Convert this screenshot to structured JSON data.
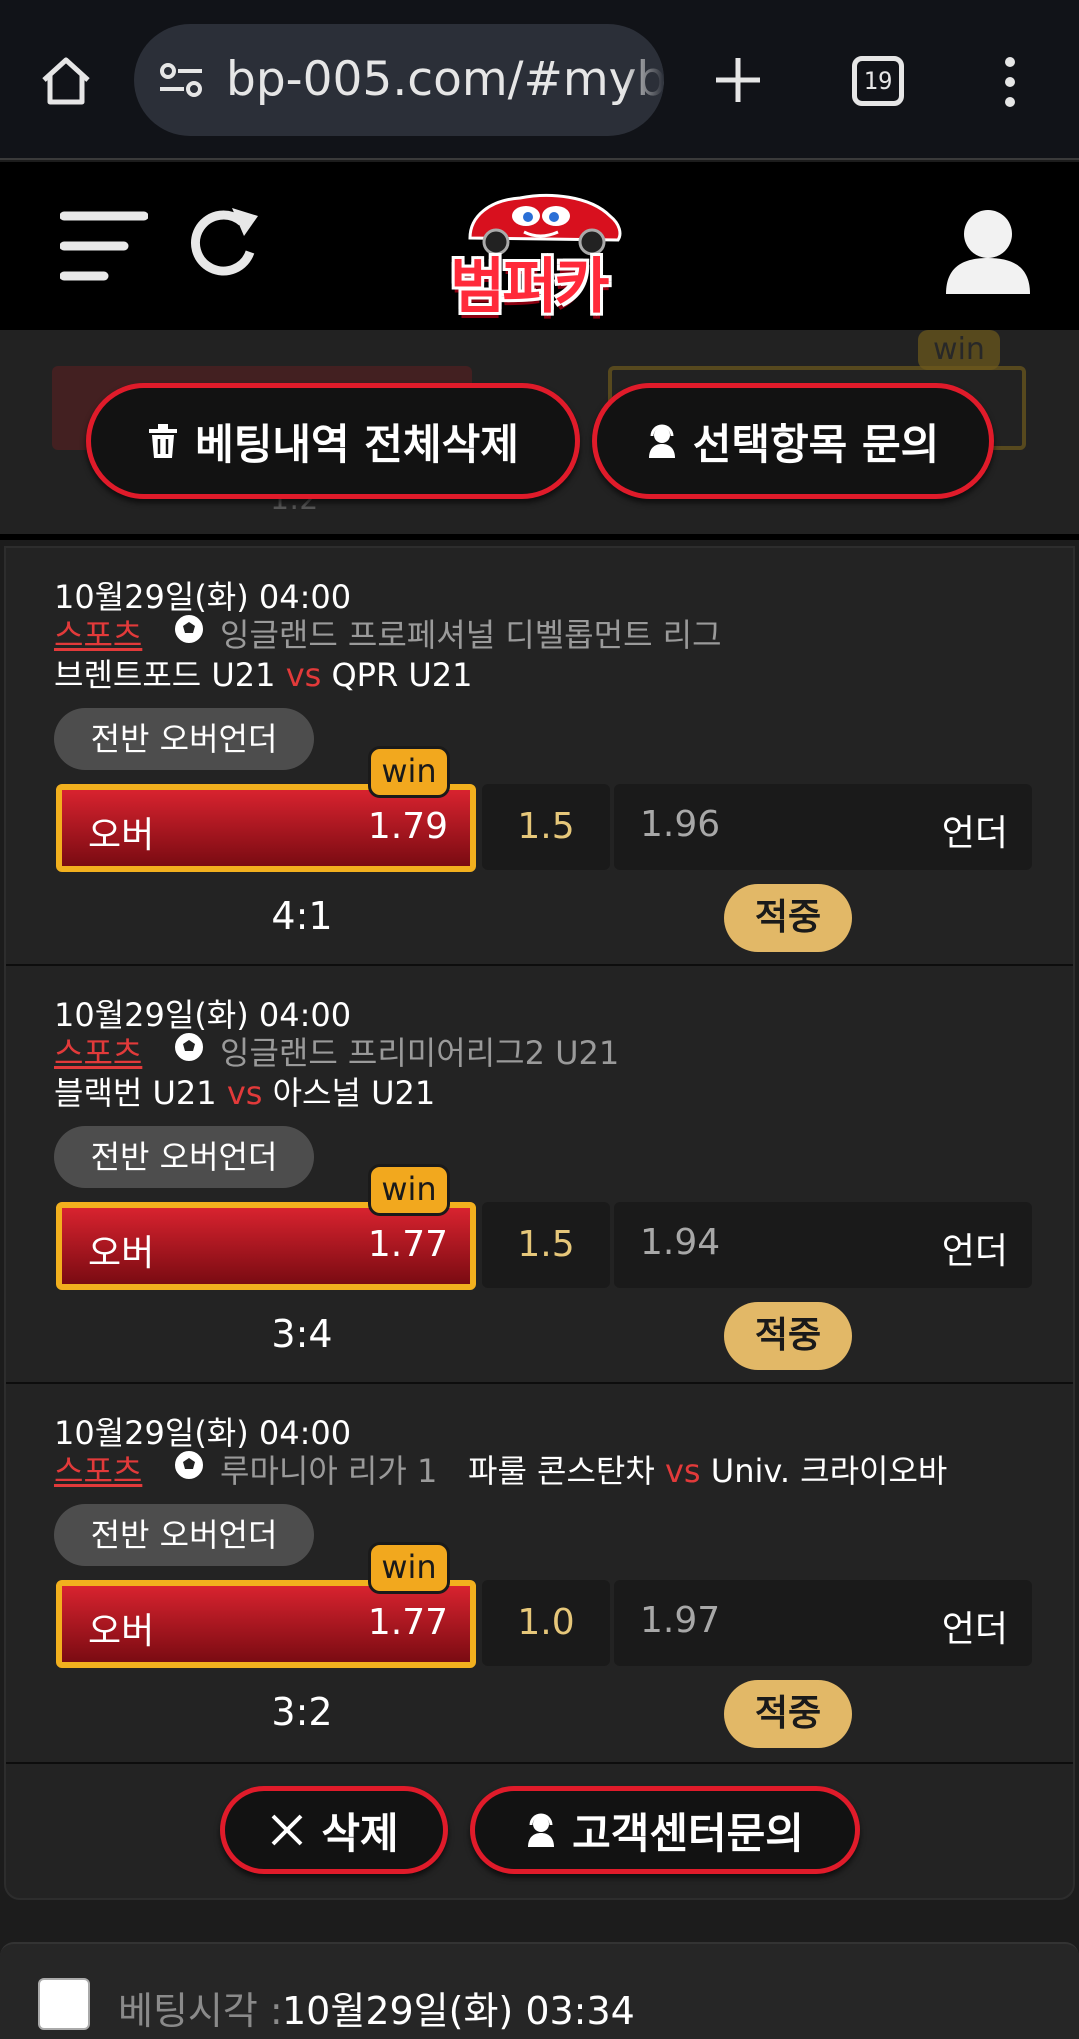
{
  "browser": {
    "url": "bp-005.com/#myb",
    "tab_count": "19"
  },
  "header": {
    "logo_text": "범퍼카"
  },
  "ghost": {
    "win": "win",
    "score": "1:2"
  },
  "actions": {
    "delete_all": "베팅내역 전체삭제",
    "inquiry_selected": "선택항목 문의",
    "delete": "삭제",
    "customer_center": "고객센터문의"
  },
  "matches": [
    {
      "datetime": "10월29일(화) 04:00",
      "category": "스포츠",
      "league": "잉글랜드 프로페셔널 디벨롭먼트 리그",
      "home": "브렌트포드 U21",
      "vs": "vs",
      "away": "QPR U21",
      "bet_type": "전반 오버언더",
      "over_label": "오버",
      "over_odds": "1.79",
      "win_tag": "win",
      "line": "1.5",
      "under_odds": "1.96",
      "under_label": "언더",
      "score": "4:1",
      "result": "적중"
    },
    {
      "datetime": "10월29일(화) 04:00",
      "category": "스포츠",
      "league": "잉글랜드 프리미어리그2 U21",
      "home": "블랙번 U21",
      "vs": "vs",
      "away": "아스널 U21",
      "bet_type": "전반 오버언더",
      "over_label": "오버",
      "over_odds": "1.77",
      "win_tag": "win",
      "line": "1.5",
      "under_odds": "1.94",
      "under_label": "언더",
      "score": "3:4",
      "result": "적중"
    },
    {
      "datetime": "10월29일(화) 04:00",
      "category": "스포츠",
      "league": "루마니아 리가 1",
      "home": "파룰 콘스탄차",
      "vs": "vs",
      "away": "Univ. 크라이오바",
      "bet_type": "전반 오버언더",
      "over_label": "오버",
      "over_odds": "1.77",
      "win_tag": "win",
      "line": "1.0",
      "under_odds": "1.97",
      "under_label": "언더",
      "score": "3:2",
      "result": "적중"
    }
  ],
  "next_bet": {
    "label": "베팅시각 :",
    "time": "10월29일(화) 03:34"
  }
}
